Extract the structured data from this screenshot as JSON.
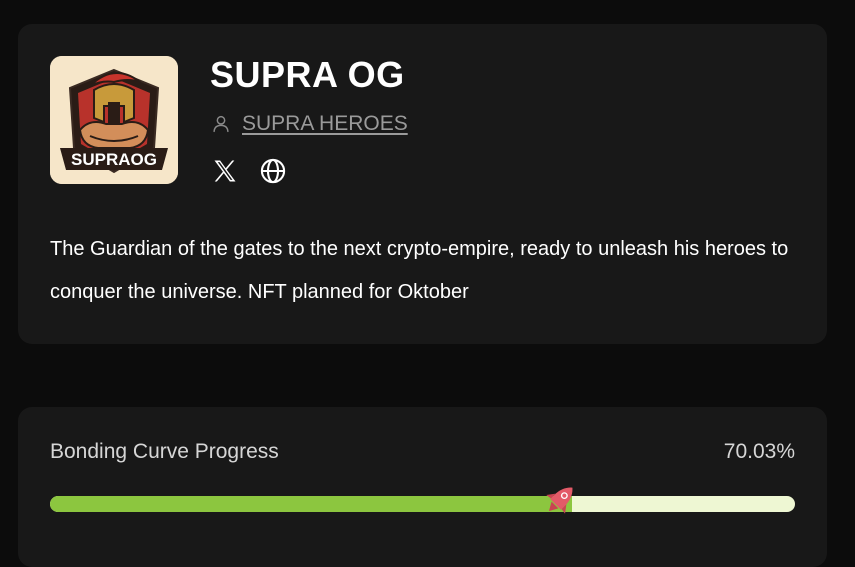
{
  "token": {
    "name": "SUPRA OG",
    "creator": "SUPRA HEROES",
    "logo_text": "SUPRAOG",
    "description": "The Guardian of the gates to the next crypto-empire, ready to unleash his heroes to conquer the universe. NFT planned for Oktober",
    "socials": [
      {
        "icon": "x-icon"
      },
      {
        "icon": "globe-icon"
      }
    ]
  },
  "progress": {
    "label": "Bonding Curve Progress",
    "value_text": "70.03%",
    "percent": 70.03,
    "fill_color": "#8cc63f",
    "track_color": "#eef7d3",
    "marker_icon": "rocket-icon"
  }
}
